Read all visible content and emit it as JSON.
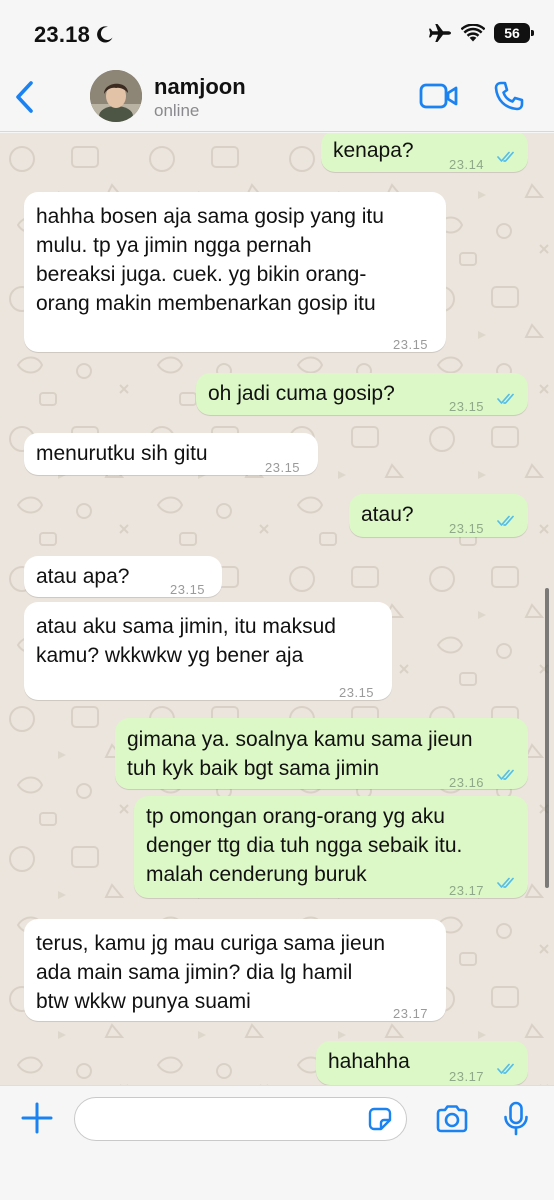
{
  "status_bar": {
    "time": "23.18",
    "battery": "56"
  },
  "header": {
    "contact_name": "namjoon",
    "contact_status": "online"
  },
  "messages": [
    {
      "dir": "out",
      "text": "kenapa?",
      "time": "23.14"
    },
    {
      "dir": "in",
      "text": "hahha bosen aja sama gosip yang itu\nmulu. tp ya jimin ngga pernah\nbereaksi juga. cuek. yg bikin orang-\norang makin membenarkan gosip itu",
      "time": "23.15"
    },
    {
      "dir": "out",
      "text": "oh jadi cuma gosip?",
      "time": "23.15"
    },
    {
      "dir": "in",
      "text": "menurutku sih gitu",
      "time": "23.15"
    },
    {
      "dir": "out",
      "text": "atau?",
      "time": "23.15"
    },
    {
      "dir": "in",
      "text": "atau apa?",
      "time": "23.15"
    },
    {
      "dir": "in",
      "text": "atau aku sama jimin, itu maksud\nkamu? wkkwkw yg bener aja",
      "time": "23.15"
    },
    {
      "dir": "out",
      "text": "gimana ya. soalnya kamu sama jieun\ntuh kyk baik bgt sama jimin",
      "time": "23.16"
    },
    {
      "dir": "out",
      "text": "tp omongan orang-orang yg aku\ndenger ttg dia tuh ngga sebaik itu.\nmalah cenderung buruk",
      "time": "23.17"
    },
    {
      "dir": "in",
      "text": "terus, kamu jg mau curiga sama jieun\nada main sama jimin? dia lg hamil\nbtw wkkw punya suami",
      "time": "23.17"
    },
    {
      "dir": "out",
      "text": "hahahha",
      "time": "23.17"
    }
  ],
  "input": {
    "value": "",
    "placeholder": ""
  },
  "icons": {
    "back": "chevron-left-icon",
    "video": "video-call-icon",
    "call": "phone-icon",
    "plus": "plus-icon",
    "sticker": "sticker-icon",
    "camera": "camera-icon",
    "mic": "microphone-icon",
    "airplane": "airplane-icon",
    "wifi": "wifi-icon",
    "moon": "moon-icon",
    "ticks": "double-check-icon"
  },
  "colors": {
    "accent": "#1b82f1",
    "incoming_bubble": "#ffffff",
    "outgoing_bubble": "#dcf8c6",
    "chat_background": "#ece5dd",
    "read_ticks": "#53bdeb"
  }
}
